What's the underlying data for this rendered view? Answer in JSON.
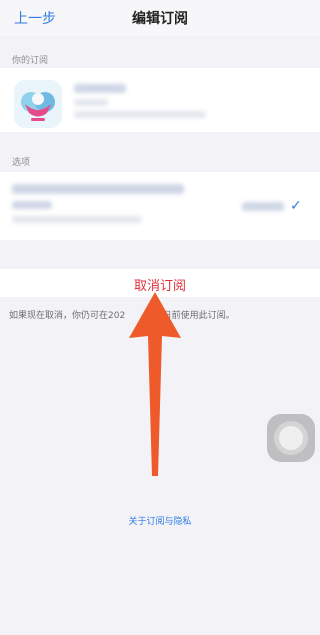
{
  "nav": {
    "back_label": "上一步",
    "title": "编辑订阅"
  },
  "subscriptions": {
    "header": "你的订阅"
  },
  "options": {
    "header": "选项"
  },
  "cancel_label": "取消订阅",
  "cancel_note": "如果现在取消，你仍可在202",
  "cancel_note_tail": "28日前使用此订阅。",
  "privacy_link": "关于订阅与隐私",
  "colors": {
    "accent": "#2f7be6",
    "destructive": "#e0303d",
    "arrow": "#ee5a2a"
  },
  "icons": {
    "check": "✓"
  }
}
